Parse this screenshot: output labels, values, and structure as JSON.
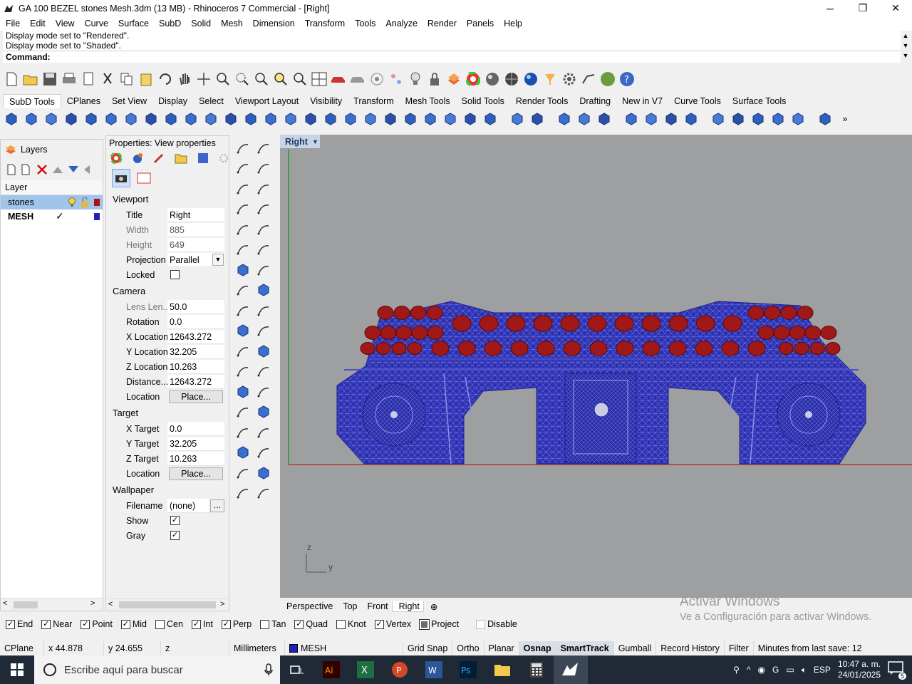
{
  "window": {
    "title": "GA 100 BEZEL stones Mesh.3dm (13 MB) - Rhinoceros 7 Commercial - [Right]",
    "minimize": "─",
    "restore": "❐",
    "close": "✕"
  },
  "menu": [
    "File",
    "Edit",
    "View",
    "Curve",
    "Surface",
    "SubD",
    "Solid",
    "Mesh",
    "Dimension",
    "Transform",
    "Tools",
    "Analyze",
    "Render",
    "Panels",
    "Help"
  ],
  "command": {
    "history": [
      "Display mode set to \"Rendered\".",
      "Display mode set to \"Shaded\"."
    ],
    "prompt": "Command:"
  },
  "toolbar_tabs": [
    "SubD Tools",
    "CPlanes",
    "Set View",
    "Display",
    "Select",
    "Viewport Layout",
    "Visibility",
    "Transform",
    "Mesh Tools",
    "Solid Tools",
    "Render Tools",
    "Drafting",
    "New in V7",
    "Curve Tools",
    "Surface Tools"
  ],
  "layers": {
    "panel_title": "Layers",
    "column_header": "Layer",
    "rows": [
      {
        "name": "stones",
        "color": "#b01010",
        "selected": true
      },
      {
        "name": "MESH",
        "color": "#2020c0",
        "current_mark": "✓",
        "selected": false
      }
    ]
  },
  "properties": {
    "title": "Properties: View properties",
    "viewport": {
      "heading": "Viewport",
      "title_label": "Title",
      "title_value": "Right",
      "width_label": "Width",
      "width_value": "885",
      "height_label": "Height",
      "height_value": "649",
      "projection_label": "Projection",
      "projection_value": "Parallel",
      "locked_label": "Locked"
    },
    "camera": {
      "heading": "Camera",
      "lens_label": "Lens Len...",
      "lens_value": "50.0",
      "rotation_label": "Rotation",
      "rotation_value": "0.0",
      "xloc_label": "X Location",
      "xloc_value": "12643.272",
      "yloc_label": "Y Location",
      "yloc_value": "32.205",
      "zloc_label": "Z Location",
      "zloc_value": "10.263",
      "dist_label": "Distance...",
      "dist_value": "12643.272",
      "location_label": "Location",
      "place_button": "Place..."
    },
    "target": {
      "heading": "Target",
      "xt_label": "X Target",
      "xt_value": "0.0",
      "yt_label": "Y Target",
      "yt_value": "32.205",
      "zt_label": "Z Target",
      "zt_value": "10.263",
      "location_label": "Location",
      "place_button": "Place..."
    },
    "wallpaper": {
      "heading": "Wallpaper",
      "filename_label": "Filename",
      "filename_value": "(none)",
      "browse": "...",
      "show_label": "Show",
      "gray_label": "Gray"
    }
  },
  "viewport": {
    "active_tab": "Right",
    "tabs": [
      "Perspective",
      "Top",
      "Front",
      "Right"
    ],
    "add_tab": "⊕",
    "axis_z": "z",
    "axis_y": "y",
    "mesh_color": "#2b2fb0",
    "stone_color": "#a01818"
  },
  "watermark": {
    "line1": "Activar Windows",
    "line2": "Ve a Configuración para activar Windows."
  },
  "osnap": [
    {
      "label": "End",
      "checked": true
    },
    {
      "label": "Near",
      "checked": true
    },
    {
      "label": "Point",
      "checked": true
    },
    {
      "label": "Mid",
      "checked": true
    },
    {
      "label": "Cen",
      "checked": false
    },
    {
      "label": "Int",
      "checked": true
    },
    {
      "label": "Perp",
      "checked": true
    },
    {
      "label": "Tan",
      "checked": false
    },
    {
      "label": "Quad",
      "checked": true
    },
    {
      "label": "Knot",
      "checked": false
    },
    {
      "label": "Vertex",
      "checked": true
    },
    {
      "label": "Project",
      "checked": true
    },
    {
      "label": "Disable",
      "checked": false
    }
  ],
  "status": {
    "cplane": "CPlane",
    "x": "x 44.878",
    "y": "y 24.655",
    "z": "z",
    "units": "Millimeters",
    "layer": "MESH",
    "grid_snap": "Grid Snap",
    "ortho": "Ortho",
    "planar": "Planar",
    "osnap": "Osnap",
    "smarttrack": "SmartTrack",
    "gumball": "Gumball",
    "record_history": "Record History",
    "filter": "Filter",
    "save": "Minutes from last save: 12"
  },
  "taskbar": {
    "search_placeholder": "Escribe aquí para buscar",
    "lang": "ESP",
    "time": "10:47 a. m.",
    "date": "24/01/2025",
    "notif": "5"
  }
}
